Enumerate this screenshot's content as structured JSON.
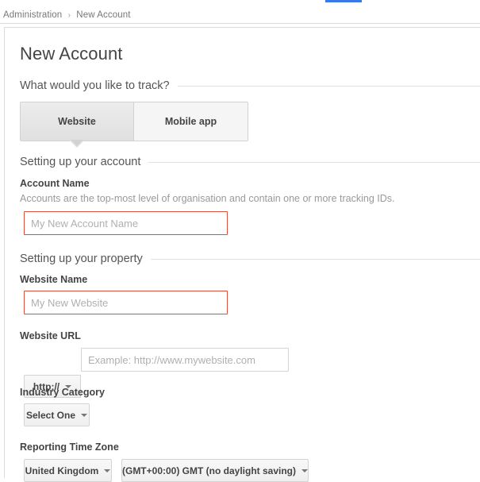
{
  "breadcrumb": {
    "parent": "Administration",
    "separator": "›",
    "current": "New Account"
  },
  "colors": {
    "tab_indicator": "#3b78e7",
    "error_border": "#d9503c",
    "panel_border": "#dcdcdc",
    "text_primary": "#444444",
    "text_muted": "#999999"
  },
  "page": {
    "title": "New Account"
  },
  "track_section": {
    "heading": "What would you like to track?",
    "tabs": [
      {
        "label": "Website",
        "selected": true
      },
      {
        "label": "Mobile app",
        "selected": false
      }
    ]
  },
  "account_section": {
    "heading": "Setting up your account",
    "account_name": {
      "label": "Account Name",
      "help": "Accounts are the top-most level of organisation and contain one or more tracking IDs.",
      "value": "",
      "placeholder": "My New Account Name"
    }
  },
  "property_section": {
    "heading": "Setting up your property",
    "website_name": {
      "label": "Website Name",
      "value": "",
      "placeholder": "My New Website"
    },
    "website_url": {
      "label": "Website URL",
      "protocol": "http://",
      "value": "",
      "placeholder": "Example: http://www.mywebsite.com"
    },
    "industry_category": {
      "label": "Industry Category",
      "selected": "Select One"
    },
    "reporting_time_zone": {
      "label": "Reporting Time Zone",
      "country": "United Kingdom",
      "zone": "(GMT+00:00) GMT (no daylight saving)"
    }
  }
}
